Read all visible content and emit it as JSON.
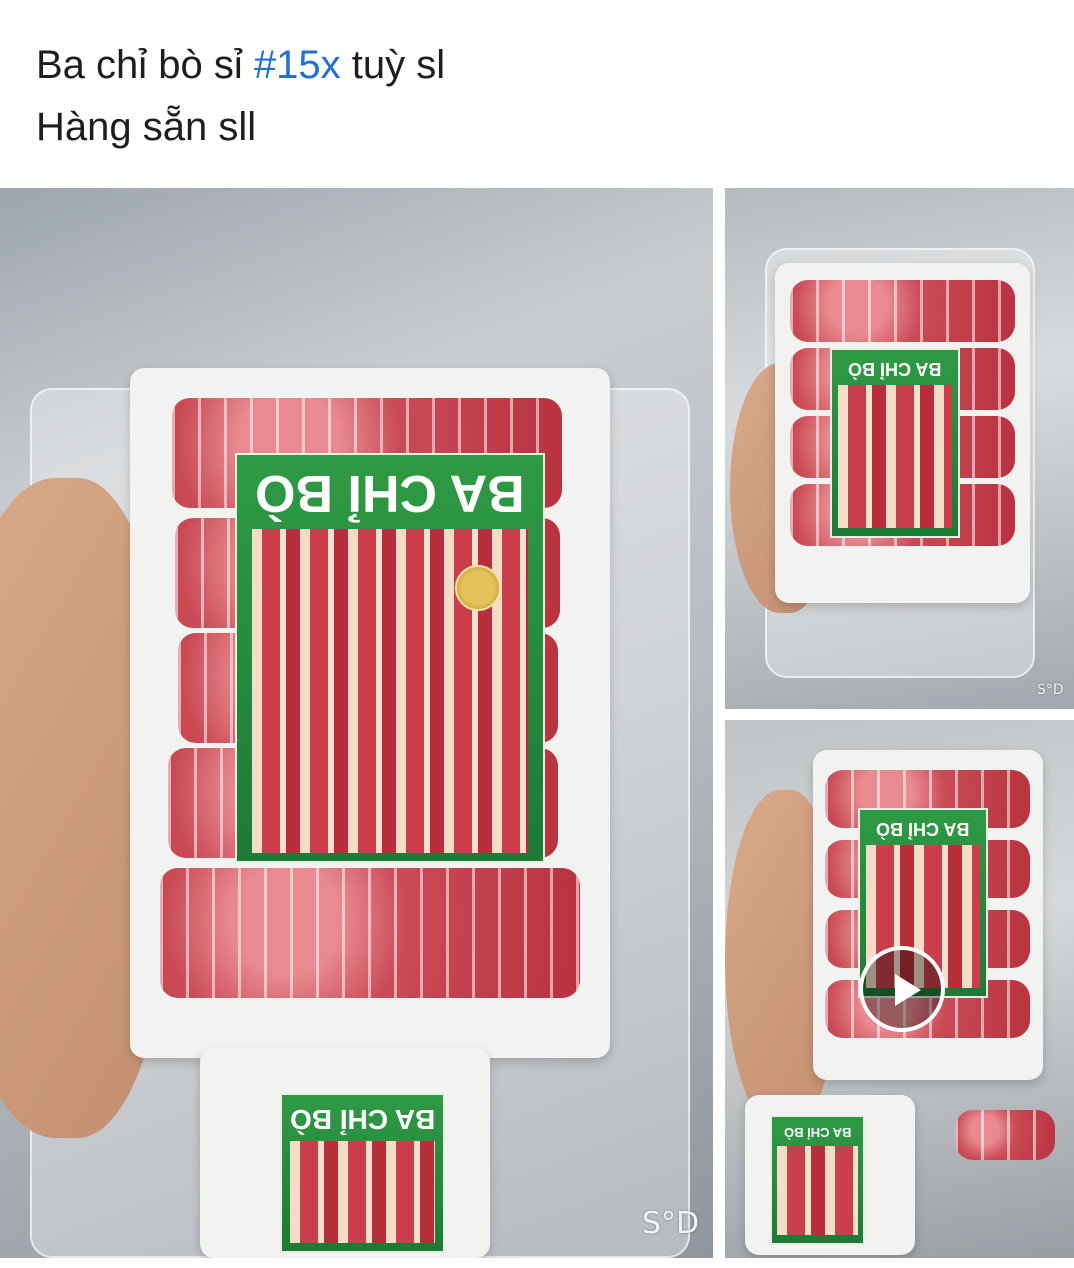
{
  "post": {
    "line1_before": "Ba chỉ bò sỉ ",
    "hashtag": "#15x",
    "line1_after": " tuỳ sl",
    "line2": "Hàng sẵn sll"
  },
  "product": {
    "label_title": "BA CHỈ BÒ"
  },
  "watermark": "S°D",
  "watermark_small": "S°D",
  "colors": {
    "hashtag": "#216fdb",
    "label_green": "#2f9a45",
    "meat_red": "#c94a55"
  },
  "icons": {
    "video": "play-icon"
  }
}
